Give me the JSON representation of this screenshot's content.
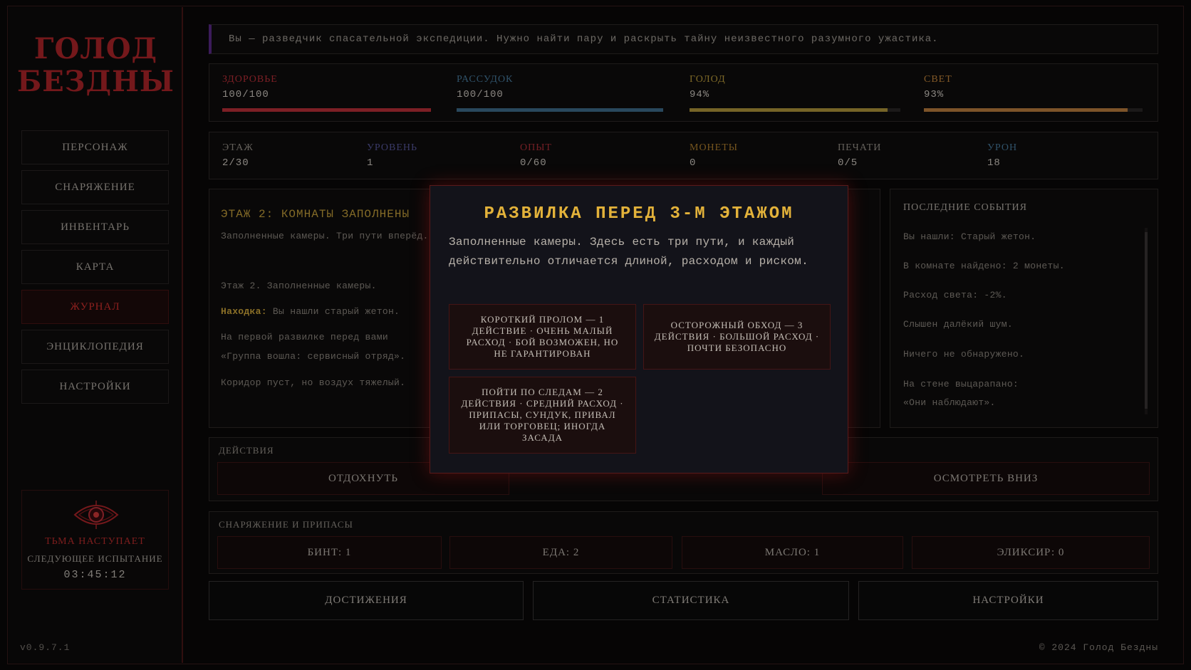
{
  "game": {
    "title_line1": "ГОЛОД",
    "title_line2": "БЕЗДНЫ",
    "version": "v0.9.7.1",
    "copyright": "© 2024 Голод Бездны"
  },
  "nav": [
    {
      "label": "ПЕРСОНАЖ",
      "active": false
    },
    {
      "label": "СНАРЯЖЕНИЕ",
      "active": false
    },
    {
      "label": "ИНВЕНТАРЬ",
      "active": false
    },
    {
      "label": "КАРТА",
      "active": false
    },
    {
      "label": "ЖУРНАЛ",
      "active": true
    },
    {
      "label": "ЭНЦИКЛОПЕДИЯ",
      "active": false
    },
    {
      "label": "НАСТРОЙКИ",
      "active": false
    }
  ],
  "darkness": {
    "title": "ТЬМА НАСТУПАЕТ",
    "subtitle": "СЛЕДУЮЩЕЕ ИСПЫТАНИЕ",
    "timer": "03:45:12"
  },
  "intro": "Вы — разведчик спасательной экспедиции. Нужно найти пару и раскрыть тайну неизвестного разумного ужастика.",
  "stats": [
    {
      "label": "ЗДОРОВЬЕ",
      "value": "100/100",
      "fraction": 1.0,
      "color": "#c0303a",
      "label_color": "#c0303a"
    },
    {
      "label": "РАССУДОК",
      "value": "100/100",
      "fraction": 1.0,
      "color": "#3f6f8f",
      "label_color": "#4a7fa3"
    },
    {
      "label": "ГОЛОД",
      "value": "94%",
      "fraction": 0.94,
      "color": "#b59a3c",
      "label_color": "#c2a23d"
    },
    {
      "label": "СВЕТ",
      "value": "93%",
      "fraction": 0.93,
      "color": "#c0813f",
      "label_color": "#c9893d"
    }
  ],
  "info": [
    {
      "label": "ЭТАЖ",
      "value": "2/30",
      "color": "#9a948c"
    },
    {
      "label": "УРОВЕНЬ",
      "value": "1",
      "color": "#5a5aa0"
    },
    {
      "label": "ОПЫТ",
      "value": "0/60",
      "color": "#b2303a"
    },
    {
      "label": "МОНЕТЫ",
      "value": "0",
      "color": "#b5832f"
    },
    {
      "label": "ПЕЧАТИ",
      "value": "0/5",
      "color": "#9a948c"
    },
    {
      "label": "УРОН",
      "value": "18",
      "color": "#4a7fa3"
    }
  ],
  "story": {
    "heading": "ЭТАЖ 2: КОМНАТЫ ЗАПОЛНЕНЫ",
    "summary": "Заполненные камеры. Три пути вперёд.",
    "line1": "Этаж 2. Заполненные камеры.",
    "find_label": "Находка:",
    "find_text": " Вы нашли старый жетон.",
    "line3": "На первой развилке перед вами",
    "line4": "«Группа вошла: сервисный отряд».",
    "line5": "Коридор пуст, но воздух тяжелый."
  },
  "events": {
    "heading": "ПОСЛЕДНИЕ СОБЫТИЯ",
    "items": [
      "Вы нашли: Старый жетон.",
      "В комнате найдено: 2 монеты.",
      "Расход света: -2%.",
      "Слышен далёкий шум.",
      "Ничего не обнаружено.",
      "На стене выцарапано:",
      "«Они наблюдают»."
    ]
  },
  "actions": {
    "title": "ДЕЙСТВИЯ",
    "rest": "ОТДОХНУТЬ",
    "look_down": "ОСМОТРЕТЬ ВНИЗ"
  },
  "supplies": {
    "title": "СНАРЯЖЕНИЕ И ПРИПАСЫ",
    "items": [
      "БИНТ: 1",
      "ЕДА: 2",
      "МАСЛО: 1",
      "ЭЛИКСИР: 0"
    ]
  },
  "bottom": [
    "ДОСТИЖЕНИЯ",
    "СТАТИСТИКА",
    "НАСТРОЙКИ"
  ],
  "modal": {
    "title": "РАЗВИЛКА ПЕРЕД 3-М ЭТАЖОМ",
    "description": "Заполненные камеры. Здесь есть три пути, и каждый действительно отличается длиной, расходом и риском.",
    "choices": [
      "КОРОТКИЙ ПРОЛОМ — 1 ДЕЙСТВИЕ · ОЧЕНЬ МАЛЫЙ РАСХОД · БОЙ ВОЗМОЖЕН, НО НЕ ГАРАНТИРОВАН",
      "ОСТОРОЖНЫЙ ОБХОД — 3 ДЕЙСТВИЯ · БОЛЬШОЙ РАСХОД · ПОЧТИ БЕЗОПАСНО",
      "ПОЙТИ ПО СЛЕДАМ — 2 ДЕЙСТВИЯ · СРЕДНИЙ РАСХОД · ПРИПАСЫ, СУНДУК, ПРИВАЛ ИЛИ ТОРГОВЕЦ; ИНОГДА ЗАСАДА"
    ]
  }
}
